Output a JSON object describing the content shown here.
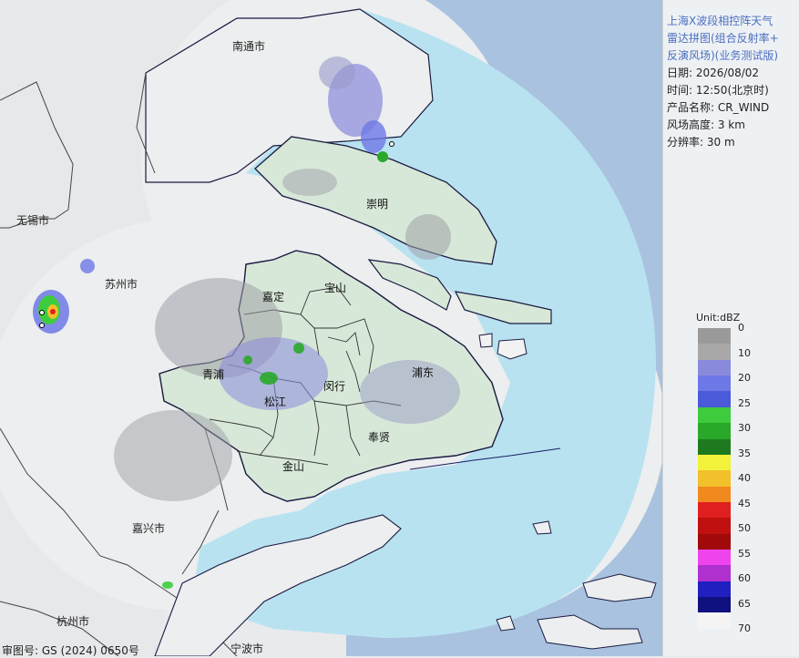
{
  "info": {
    "title_lines": [
      "上海X波段相控阵天气",
      "雷达拼图(组合反射率+",
      "反演风场)(业务测试版)"
    ],
    "date": "日期: 2026/08/02",
    "time": "时间: 12:50(北京时)",
    "product": "产品名称: CR_WIND",
    "wind_height": "风场高度: 3 km",
    "resolution": "分辨率: 30 m"
  },
  "legend": {
    "unit": "Unit:dBZ",
    "ticks": [
      "0",
      "10",
      "20",
      "25",
      "30",
      "35",
      "40",
      "45",
      "50",
      "55",
      "60",
      "65",
      "70"
    ],
    "colors": [
      "#9a9a9a",
      "#a8a8a8",
      "#8a8adc",
      "#6e78e6",
      "#4a5ad8",
      "#3ecc3e",
      "#2aa82a",
      "#1e7a1e",
      "#f2f23a",
      "#f2c02a",
      "#f08a1e",
      "#e02020",
      "#c01010",
      "#a00a0a",
      "#ee44ee",
      "#b030d0",
      "#2020c0",
      "#101080",
      "#f4f4f4"
    ]
  },
  "map_labels": {
    "nantong": "南通市",
    "chongming": "崇明",
    "wuxi": "无锡市",
    "suzhou": "苏州市",
    "jiading": "嘉定",
    "baoshan": "宝山",
    "qingpu": "青浦",
    "pudong": "浦东",
    "songjiang": "松江",
    "minhang": "闵行",
    "fengxian": "奉贤",
    "jinshan": "金山",
    "jiaxing": "嘉兴市",
    "hangzhou": "杭州市",
    "ningbo": "宁波市"
  },
  "approval": "审图号: GS (2024) 0650号",
  "colors": {
    "land_outside": "#e9eaec",
    "coverage": "#e6e8ea",
    "sea": "#b8e1f0",
    "outer_sea": "#a8c0dc",
    "shanghai_land": "#d6e6d6",
    "panel_bg": "#eef1f4"
  }
}
